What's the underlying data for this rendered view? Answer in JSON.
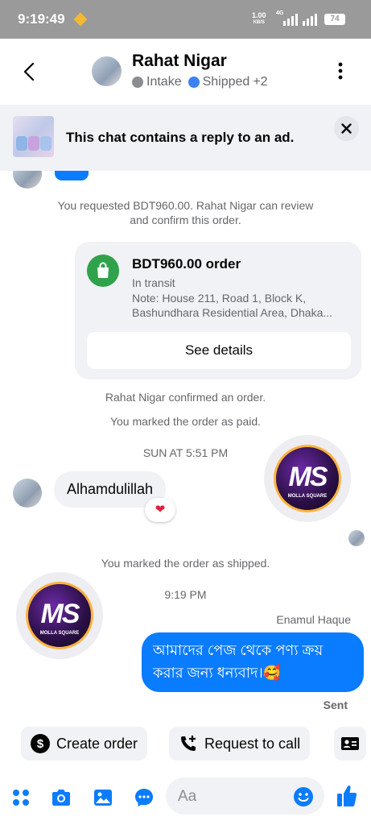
{
  "status_bar": {
    "time": "9:19:49",
    "speed_value": "1.00",
    "speed_unit": "KB/S",
    "network": "4G",
    "battery": "74"
  },
  "header": {
    "contact_name": "Rahat Nigar",
    "tags": [
      {
        "label": "Intake",
        "color": "#8a8d91"
      },
      {
        "label": "Shipped",
        "color": "#3b82f6"
      }
    ],
    "more_tags": "+2"
  },
  "ad_banner": {
    "text": "This chat contains a reply to an ad."
  },
  "messages": {
    "order_request": "You requested BDT960.00. Rahat Nigar can review and confirm this order.",
    "order_card": {
      "title": "BDT960.00 order",
      "status": "In transit",
      "note": "Note: House 211, Road 1, Block K, Bashundhara Residential Area, Dhaka...",
      "details_button": "See details"
    },
    "confirmed": "Rahat Nigar confirmed an order.",
    "paid": "You marked the order as paid.",
    "timestamp_1": "SUN AT 5:51 PM",
    "incoming_text": "Alhamdulillah",
    "reaction": "❤",
    "shipped": "You marked the order as shipped.",
    "timestamp_2": "9:19 PM",
    "sender_name": "Enamul Haque",
    "outgoing_text_line1": "আমাদের পেজ থেকে পণ্য ক্রয়",
    "outgoing_text_line2": "করার জন্য ধন্যবাদ।🥰",
    "delivery_status": "Sent"
  },
  "watermark": {
    "logo_text": "MS",
    "logo_subtext": "MOLLA SQUARE"
  },
  "quick_actions": {
    "create_order": "Create order",
    "request_call": "Request to call"
  },
  "composer": {
    "placeholder": "Aa"
  },
  "colors": {
    "accent": "#0a7cff",
    "order_green": "#31a24c",
    "status_bar": "#9a9a9a"
  }
}
